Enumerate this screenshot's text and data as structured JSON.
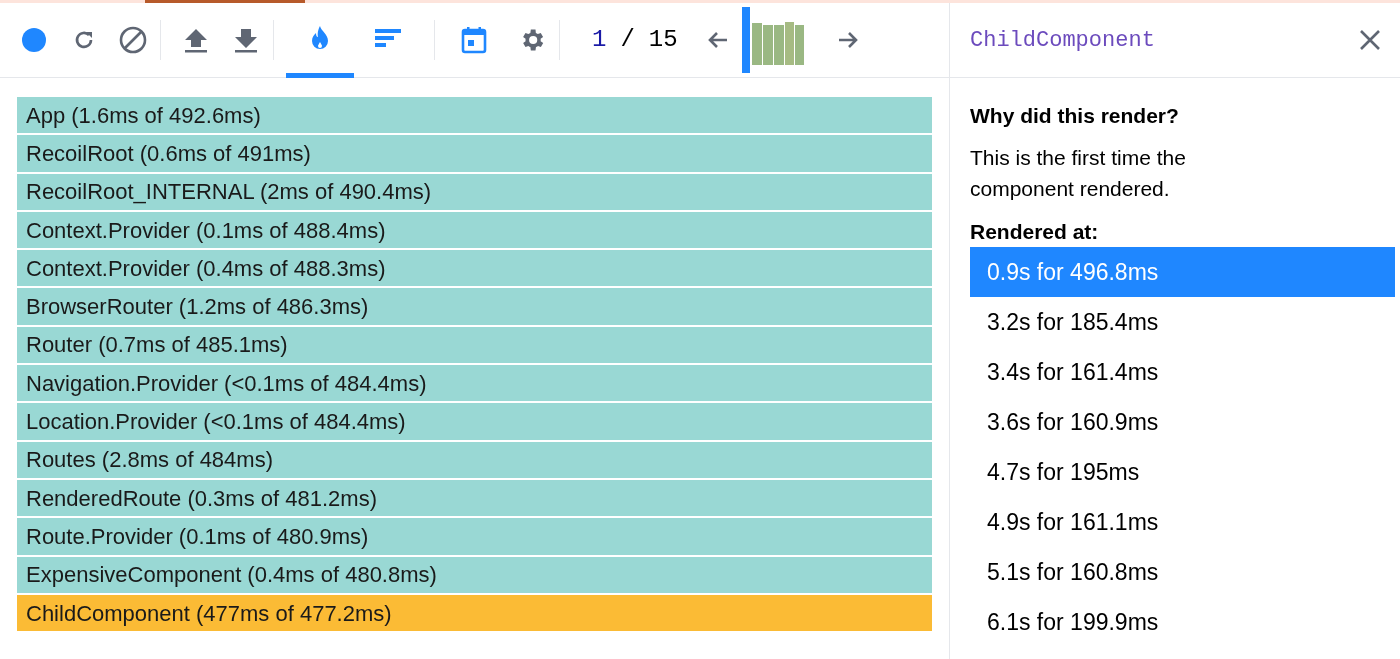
{
  "toolbar": {
    "tabs": [
      {
        "selected": true
      },
      {
        "selected": false
      }
    ],
    "commit_index": "1",
    "commit_separator": "/",
    "commit_total": "15"
  },
  "flamegraph": {
    "rows": [
      {
        "label": "App (1.6ms of 492.6ms)",
        "selected": false
      },
      {
        "label": "RecoilRoot (0.6ms of 491ms)",
        "selected": false
      },
      {
        "label": "RecoilRoot_INTERNAL (2ms of 490.4ms)",
        "selected": false
      },
      {
        "label": "Context.Provider (0.1ms of 488.4ms)",
        "selected": false
      },
      {
        "label": "Context.Provider (0.4ms of 488.3ms)",
        "selected": false
      },
      {
        "label": "BrowserRouter (1.2ms of 486.3ms)",
        "selected": false
      },
      {
        "label": "Router (0.7ms of 485.1ms)",
        "selected": false
      },
      {
        "label": "Navigation.Provider (<0.1ms of 484.4ms)",
        "selected": false
      },
      {
        "label": "Location.Provider (<0.1ms of 484.4ms)",
        "selected": false
      },
      {
        "label": "Routes (2.8ms of 484ms)",
        "selected": false
      },
      {
        "label": "RenderedRoute (0.3ms of 481.2ms)",
        "selected": false
      },
      {
        "label": "Route.Provider (0.1ms of 480.9ms)",
        "selected": false
      },
      {
        "label": "ExpensiveComponent (0.4ms of 480.8ms)",
        "selected": false
      },
      {
        "label": "ChildComponent (477ms of 477.2ms)",
        "selected": true
      }
    ]
  },
  "sidebar": {
    "title": "ChildComponent",
    "why_heading": "Why did this render?",
    "why_text": "This is the first time the component rendered.",
    "rendered_at_heading": "Rendered at:",
    "rendered_at": [
      {
        "label": "0.9s for 496.8ms",
        "selected": true
      },
      {
        "label": "3.2s for 185.4ms",
        "selected": false
      },
      {
        "label": "3.4s for 161.4ms",
        "selected": false
      },
      {
        "label": "3.6s for 160.9ms",
        "selected": false
      },
      {
        "label": "4.7s for 195ms",
        "selected": false
      },
      {
        "label": "4.9s for 161.1ms",
        "selected": false
      },
      {
        "label": "5.1s for 160.8ms",
        "selected": false
      },
      {
        "label": "6.1s for 199.9ms",
        "selected": false
      }
    ]
  }
}
